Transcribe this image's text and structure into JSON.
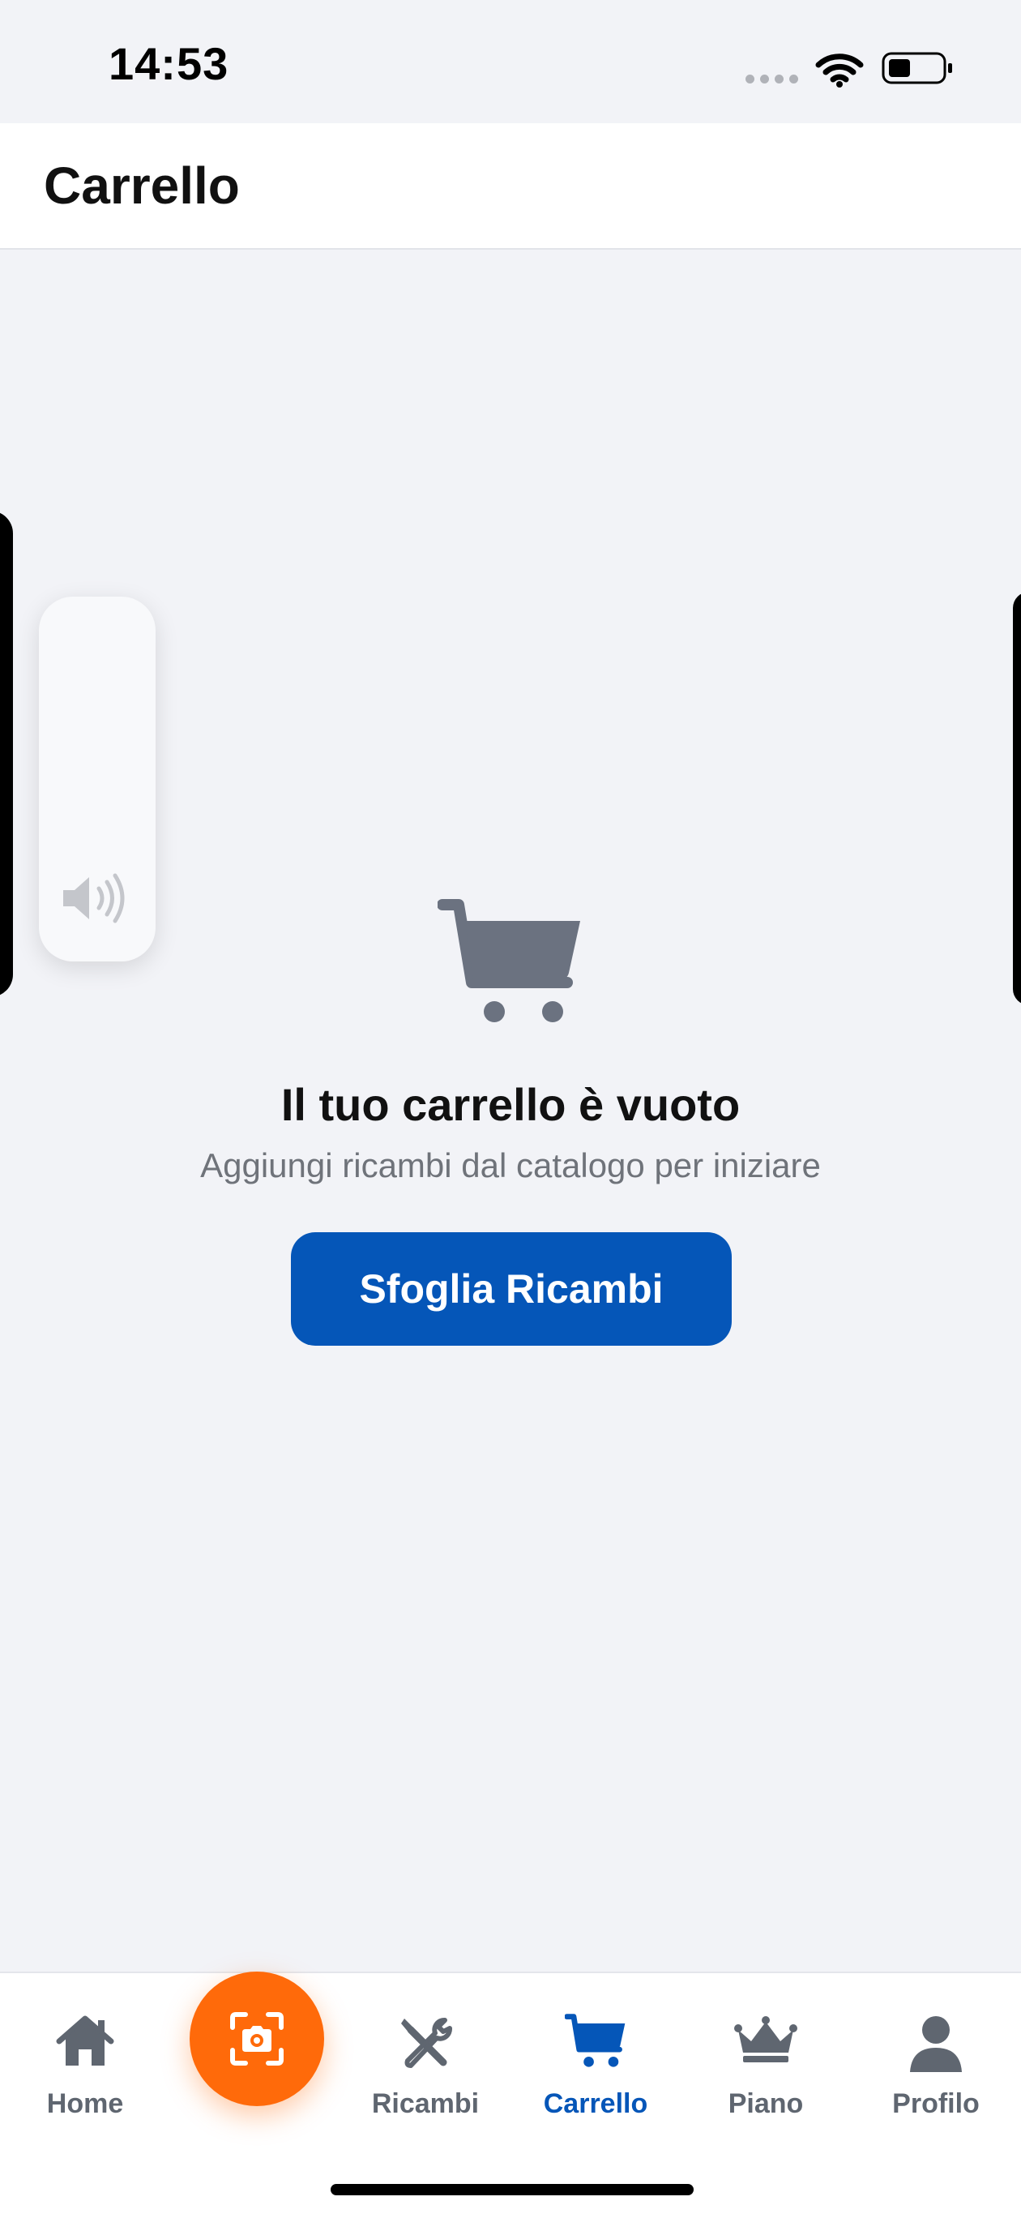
{
  "status_bar": {
    "time": "14:53"
  },
  "header": {
    "title": "Carrello"
  },
  "empty_state": {
    "icon": "shopping-cart-icon",
    "title": "Il tuo carrello è vuoto",
    "subtitle": "Aggiungi ricambi dal catalogo per iniziare",
    "button_label": "Sfoglia Ricambi"
  },
  "volume_hud": {
    "icon": "speaker-icon"
  },
  "tab_bar": {
    "items": [
      {
        "label": "Home",
        "icon": "home-icon",
        "active": false
      },
      {
        "label": "",
        "icon": "camera-scan-icon",
        "active": false
      },
      {
        "label": "Ricambi",
        "icon": "tools-icon",
        "active": false
      },
      {
        "label": "Carrello",
        "icon": "cart-icon",
        "active": true
      },
      {
        "label": "Piano",
        "icon": "crown-icon",
        "active": false
      },
      {
        "label": "Profilo",
        "icon": "user-icon",
        "active": false
      }
    ]
  },
  "colors": {
    "accent": "#0556b8",
    "scan_button": "#ff6a0a",
    "background": "#f2f3f7",
    "muted_text": "#6f737a",
    "icon_gray": "#6b7280"
  }
}
